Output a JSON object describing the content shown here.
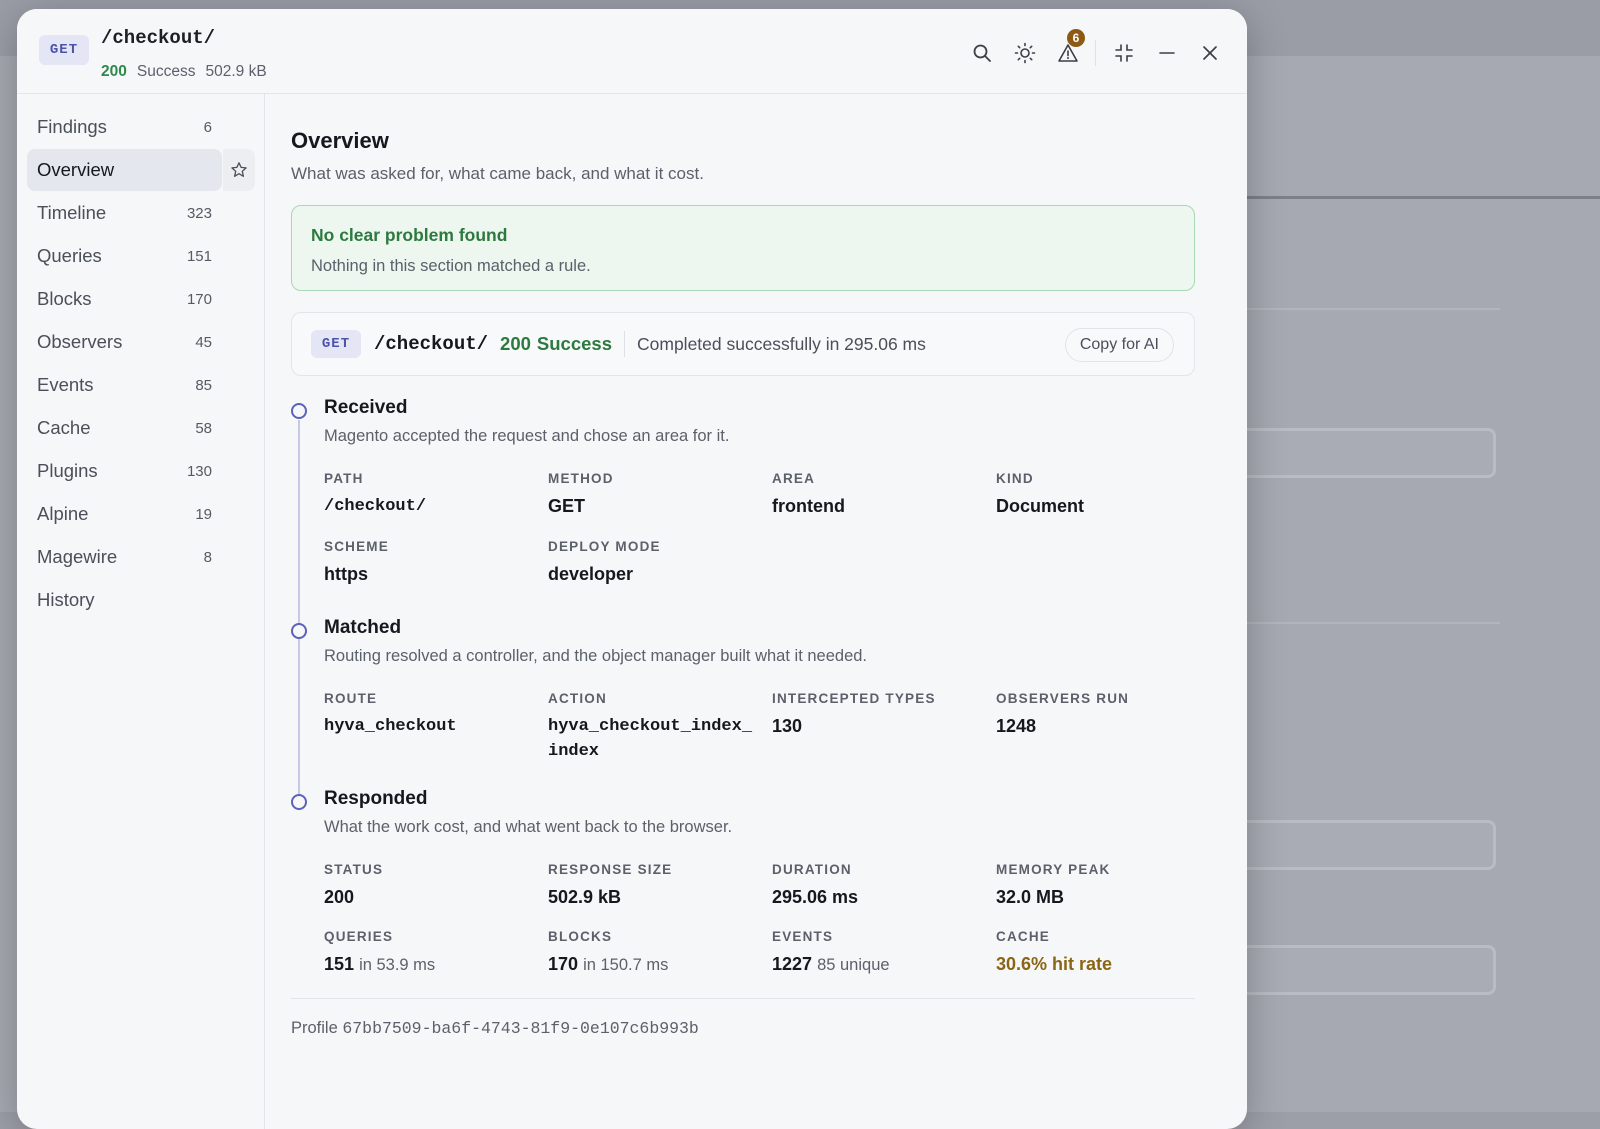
{
  "request": {
    "method": "GET",
    "path": "/checkout/",
    "status_code": "200",
    "status_text": "Success",
    "size": "502.9 kB"
  },
  "header": {
    "warnings_count": "6",
    "icons": [
      "search-icon",
      "theme-icon",
      "warning-icon",
      "collapse-icon",
      "minimize-icon",
      "close-icon"
    ]
  },
  "sidebar": {
    "items": [
      {
        "label": "Findings",
        "count": "6"
      },
      {
        "label": "Overview",
        "count": ""
      },
      {
        "label": "Timeline",
        "count": "323"
      },
      {
        "label": "Queries",
        "count": "151"
      },
      {
        "label": "Blocks",
        "count": "170"
      },
      {
        "label": "Observers",
        "count": "45"
      },
      {
        "label": "Events",
        "count": "85"
      },
      {
        "label": "Cache",
        "count": "58"
      },
      {
        "label": "Plugins",
        "count": "130"
      },
      {
        "label": "Alpine",
        "count": "19"
      },
      {
        "label": "Magewire",
        "count": "8"
      },
      {
        "label": "History",
        "count": ""
      }
    ]
  },
  "overview": {
    "title": "Overview",
    "subtitle": "What was asked for, what came back, and what it cost.",
    "alert_title": "No clear problem found",
    "alert_body": "Nothing in this section matched a rule.",
    "summary_message": "Completed successfully in 295.06 ms",
    "copy_label": "Copy for AI"
  },
  "steps": {
    "received": {
      "title": "Received",
      "desc": "Magento accepted the request and chose an area for it.",
      "path_label": "PATH",
      "path": "/checkout/",
      "method_label": "METHOD",
      "method": "GET",
      "area_label": "AREA",
      "area": "frontend",
      "kind_label": "KIND",
      "kind": "Document",
      "scheme_label": "SCHEME",
      "scheme": "https",
      "deploy_label": "DEPLOY MODE",
      "deploy": "developer"
    },
    "matched": {
      "title": "Matched",
      "desc": "Routing resolved a controller, and the object manager built what it needed.",
      "route_label": "ROUTE",
      "route": "hyva_checkout",
      "action_label": "ACTION",
      "action": "hyva_checkout_index_index",
      "intercepted_label": "INTERCEPTED TYPES",
      "intercepted": "130",
      "observers_label": "OBSERVERS RUN",
      "observers": "1248"
    },
    "responded": {
      "title": "Responded",
      "desc": "What the work cost, and what went back to the browser.",
      "status_label": "STATUS",
      "status": "200",
      "size_label": "RESPONSE SIZE",
      "size": "502.9 kB",
      "duration_label": "DURATION",
      "duration": "295.06 ms",
      "memory_label": "MEMORY PEAK",
      "memory": "32.0 MB",
      "queries_label": "QUERIES",
      "queries": "151",
      "queries_unit": "in 53.9 ms",
      "blocks_label": "BLOCKS",
      "blocks": "170",
      "blocks_unit": "in 150.7 ms",
      "events_label": "EVENTS",
      "events": "1227",
      "events_unit": "85 unique",
      "cache_label": "CACHE",
      "cache": "30.6% hit rate"
    }
  },
  "profile": {
    "label": "Profile",
    "id": "67bb7509-ba6f-4743-81f9-0e107c6b993b"
  },
  "colors": {
    "accent": "#5b62b8",
    "success": "#2d7a3f",
    "warning": "#8a6614"
  }
}
